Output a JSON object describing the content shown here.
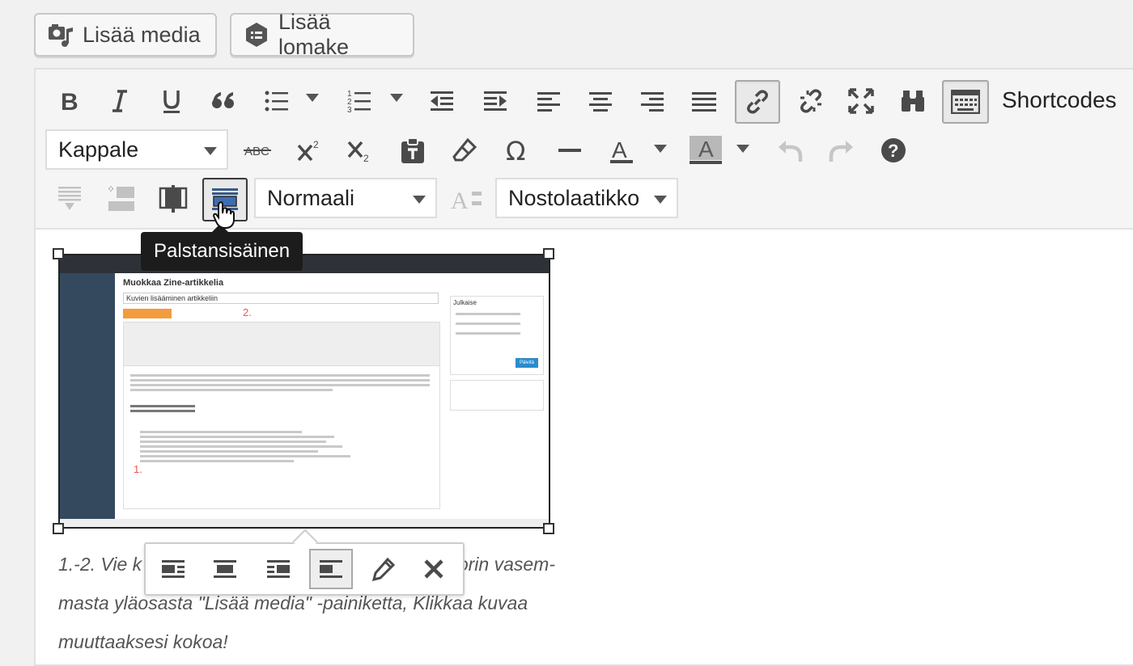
{
  "top_buttons": {
    "add_media": "Lisää media",
    "add_form": "Lisää lomake"
  },
  "toolbar": {
    "shortcodes_label": "Shortcodes",
    "format_select": "Kappale",
    "style_select": "Normaali",
    "box_select": "Nostolaatikko",
    "row1_icons": [
      "bold-icon",
      "italic-icon",
      "underline-icon",
      "blockquote-icon",
      "bullet-list-icon",
      "numbered-list-icon",
      "outdent-icon",
      "indent-icon",
      "align-left-icon",
      "align-center-icon",
      "align-right-icon",
      "justify-icon",
      "link-icon",
      "unlink-icon",
      "fullscreen-icon",
      "find-icon",
      "shortcodes-icon"
    ],
    "row2_icons": [
      "strikethrough-icon",
      "superscript-icon",
      "subscript-icon",
      "paste-text-icon",
      "clear-format-icon",
      "special-char-icon",
      "horizontal-line-icon",
      "text-color-icon",
      "background-color-icon",
      "undo-icon",
      "redo-icon",
      "help-icon"
    ],
    "row3_icons": [
      "insert-more-icon",
      "insert-block-icon",
      "two-column-icon",
      "inline-column-icon",
      "font-size-icon"
    ]
  },
  "tooltip": "Palstansisäinen",
  "image_toolbar": [
    "align-left-icon",
    "align-center-icon",
    "align-right-icon",
    "align-none-icon",
    "edit-icon",
    "remove-icon"
  ],
  "caption": "1.-2. Vie kursori haluamaasi kohtaan ja klikkaa editorin vasem-masta yläosasta \"Lisää media\" -painiketta, Klikkaa kuvaa muuttaaksesi kokoa!",
  "caption_visible": {
    "line1_left": "1.-2. Vie k",
    "line1_right": "orin vasem-",
    "line2": "masta yläosasta \"Lisää media\" -painiketta, Klikkaa kuvaa",
    "line3": "muuttaaksesi kokoa!"
  },
  "thumbnail": {
    "heading": "Muokkaa Zine-artikkelia",
    "title_field": "Kuvien lisääminen artikkeliin",
    "marker_1": "1.",
    "marker_2": "2.",
    "publish_panel": "Julkaise",
    "publish_button": "Päivitä"
  }
}
